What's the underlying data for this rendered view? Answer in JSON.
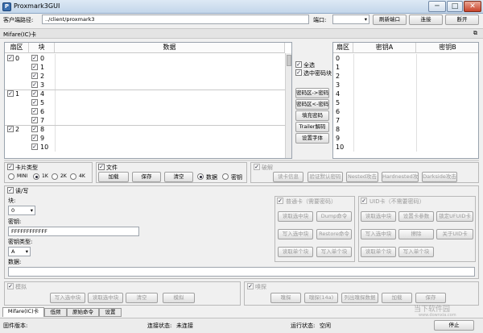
{
  "window": {
    "title": "Proxmark3GUI",
    "min_glyph": "─",
    "max_glyph": "□",
    "close_glyph": "✕"
  },
  "top": {
    "client_path_label": "客户端路径:",
    "client_path_value": "../client/proxmark3",
    "port_label": "端口:",
    "port_value": "",
    "refresh_button": "刷新端口",
    "connect_button": "连接",
    "disconnect_button": "断开"
  },
  "mifare": {
    "title": "Mifare(IC)卡",
    "data_grid": {
      "col_sector": "扇区",
      "col_block": "块",
      "col_data": "数据",
      "rows": [
        {
          "sector": "0",
          "block": "0"
        },
        {
          "sector": "",
          "block": "1"
        },
        {
          "sector": "",
          "block": "2"
        },
        {
          "sector": "",
          "block": "3"
        },
        {
          "sector": "1",
          "block": "4"
        },
        {
          "sector": "",
          "block": "5"
        },
        {
          "sector": "",
          "block": "6"
        },
        {
          "sector": "",
          "block": "7"
        },
        {
          "sector": "2",
          "block": "8"
        },
        {
          "sector": "",
          "block": "9"
        },
        {
          "sector": "",
          "block": "10"
        }
      ]
    },
    "select_all": "全选",
    "select_key_block": "选中密码块",
    "btn_key_to_data": "密码区->密码",
    "btn_data_to_key": "密码区<-密码",
    "btn_fill_key": "填充密码",
    "btn_trailer_decode": "Trailer解码",
    "btn_set_font": "设置字体",
    "key_grid": {
      "col_sector": "扇区",
      "col_keya": "密钥A",
      "col_keyb": "密钥B",
      "rows": [
        "0",
        "1",
        "2",
        "3",
        "4",
        "5",
        "6",
        "7",
        "8",
        "9",
        "10"
      ]
    },
    "card_type": {
      "title": "卡片类型",
      "options": [
        "MINI",
        "1K",
        "2K",
        "4K"
      ],
      "selected": "1K"
    },
    "file": {
      "title": "文件",
      "load": "加载",
      "save": "保存",
      "clear": "清空",
      "radio_data": "数据",
      "radio_key": "密钥"
    },
    "crack": {
      "title": "破解",
      "buttons": [
        "读卡信息",
        "验证默认密码",
        "Nested攻击",
        "Hardnested攻击",
        "Darkside攻击"
      ]
    },
    "rw": {
      "title": "读/写",
      "block_label": "块:",
      "block_value": "0",
      "key_label": "密钥:",
      "key_value": "FFFFFFFFFFFF",
      "key_type_label": "密钥类型:",
      "key_type_value": "A",
      "data_label": "数据:",
      "normal": {
        "title": "普通卡（需要密码）",
        "buttons": [
          "读取选中块",
          "Dump命令",
          "写入选中块",
          "Restore命令",
          "读取单个块",
          "写入单个块"
        ]
      },
      "uid": {
        "title": "UID卡（不需要密码）",
        "buttons": [
          "读取选中块",
          "设置卡参数",
          "锁定UFUID卡",
          "写入选中块",
          "擦除",
          "关于UID卡",
          "读取单个块",
          "写入单个块"
        ]
      }
    },
    "sim": {
      "title": "模拟",
      "buttons": [
        "写入选中块",
        "读取选中块",
        "清空",
        "模拟"
      ]
    },
    "sniff": {
      "title": "嗅探",
      "buttons": [
        "嗅探",
        "嗅探(14a)",
        "列出嗅探数据",
        "加载",
        "保存"
      ]
    }
  },
  "tabs": [
    "Mifare(IC)卡",
    "低频",
    "原始命令",
    "设置"
  ],
  "status": {
    "firmware_label": "固件版本:",
    "firmware_value": "",
    "conn_label": "连接状态:",
    "conn_value": "未连接",
    "run_label": "运行状态:",
    "run_value": "空闲",
    "stop_button": "停止"
  },
  "watermark": {
    "text": "当下软件园",
    "sub": "www.downxia.com"
  }
}
